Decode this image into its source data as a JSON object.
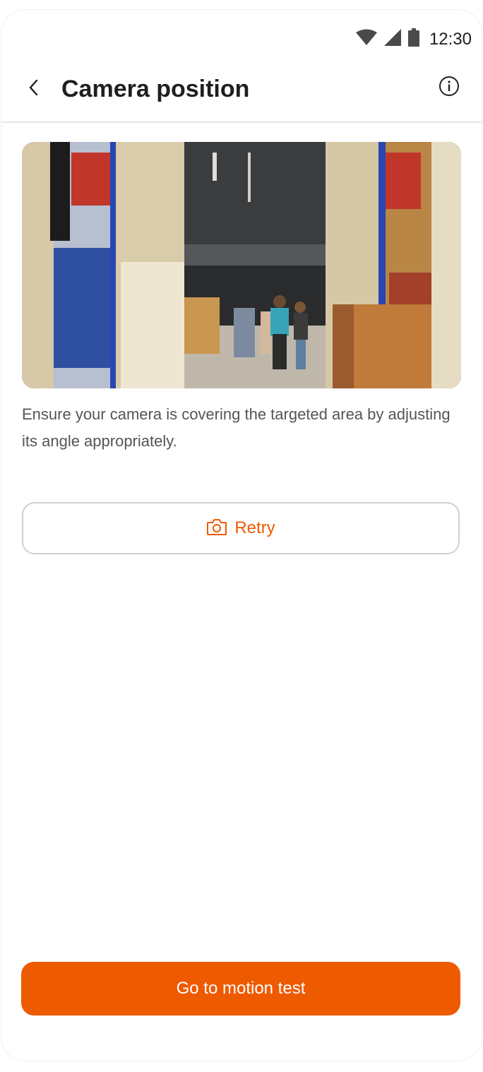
{
  "status_bar": {
    "time": "12:30",
    "icons": [
      "wifi-icon",
      "cellular-signal-icon",
      "battery-icon"
    ]
  },
  "header": {
    "title": "Camera position",
    "back_icon": "chevron-left-icon",
    "info_icon": "info-icon"
  },
  "preview": {
    "icon": "camera-preview-image"
  },
  "instructions": "Ensure your camera is covering the targeted area by adjusting its angle appropriately.",
  "retry": {
    "label": "Retry",
    "icon": "camera-icon"
  },
  "primary_action": {
    "label": "Go to motion test"
  },
  "colors": {
    "accent": "#ee5a00",
    "text_primary": "#1f1f1f",
    "text_secondary": "#555555",
    "divider": "#e8e8e8"
  }
}
